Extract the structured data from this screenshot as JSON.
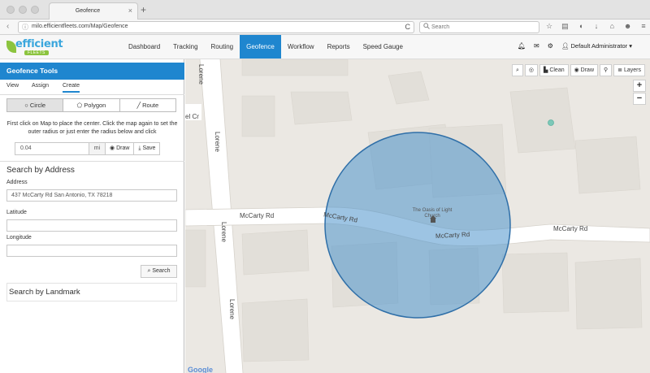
{
  "browser": {
    "tab_title": "Geofence",
    "tab_close": "×",
    "new_tab": "+",
    "url": "milo.efficientfleets.com/Map/Geofence",
    "search_placeholder": "Search",
    "nav_back": "‹",
    "nav_info": "ⓘ",
    "reload": "C",
    "toolbar_icons": [
      "star-icon",
      "reader-icon",
      "pocket-icon",
      "download-icon",
      "home-icon",
      "face-icon",
      "menu-icon"
    ]
  },
  "header": {
    "logo_word": "efficient",
    "logo_sub": "FLEETS",
    "nav": [
      {
        "label": "Dashboard"
      },
      {
        "label": "Tracking"
      },
      {
        "label": "Routing"
      },
      {
        "label": "Geofence"
      },
      {
        "label": "Workflow"
      },
      {
        "label": "Reports"
      },
      {
        "label": "Speed Gauge"
      }
    ],
    "user": "Default Administrator",
    "user_caret": "▾"
  },
  "sidebar": {
    "title": "Geofence Tools",
    "subtabs": [
      "View",
      "Assign",
      "Create"
    ],
    "shape_tabs": [
      "Circle",
      "Polygon",
      "Route"
    ],
    "instructions": "First click on Map to place the center. Click the map again to set the outer radius or just enter the radius below and click",
    "radius_value": "0.04",
    "radius_unit": "mi",
    "draw_label": "Draw",
    "save_label": "Save",
    "search_by_address": "Search by Address",
    "address_label": "Address",
    "address_value": "437 McCarty Rd San Antonio, TX 78218",
    "latitude_label": "Latitude",
    "latitude_value": "",
    "longitude_label": "Longitude",
    "longitude_value": "",
    "search_label": "Search",
    "search_by_landmark": "Search by Landmark"
  },
  "map": {
    "tools": [
      "Clean",
      "Draw",
      "Layers"
    ],
    "zoom_in": "+",
    "zoom_out": "−",
    "labels": {
      "mccarty_left": "McCarty Rd",
      "mccarty_mid": "McCarty Rd",
      "mccarty_center": "McCarty Rd",
      "mccarty_right": "McCarty Rd",
      "lorene_top": "Lorene",
      "lorene_upper": "Lorene",
      "lorene_mid": "Lorene",
      "lorene_low": "Lorene",
      "el_cr": "el Cr",
      "church": "The Oasis of Light Church"
    },
    "attribution": "Google",
    "colors": {
      "land": "#ebe8e3",
      "road": "#ffffff",
      "building": "#e0ddd7",
      "geofence_fill": "#4c93cc",
      "geofence_stroke": "#2f6fa8",
      "header_blue": "#1f86cf"
    }
  }
}
